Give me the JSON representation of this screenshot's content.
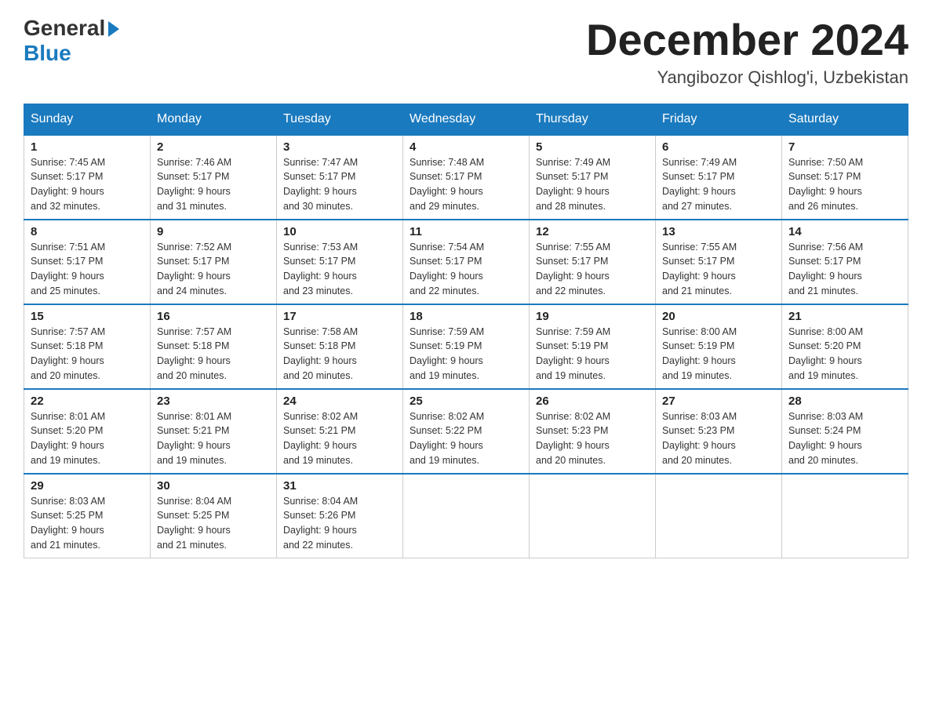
{
  "logo": {
    "general": "General",
    "blue": "Blue"
  },
  "title": "December 2024",
  "location": "Yangibozor Qishlog'i, Uzbekistan",
  "headers": [
    "Sunday",
    "Monday",
    "Tuesday",
    "Wednesday",
    "Thursday",
    "Friday",
    "Saturday"
  ],
  "weeks": [
    [
      {
        "day": "1",
        "sunrise": "7:45 AM",
        "sunset": "5:17 PM",
        "daylight": "9 hours and 32 minutes."
      },
      {
        "day": "2",
        "sunrise": "7:46 AM",
        "sunset": "5:17 PM",
        "daylight": "9 hours and 31 minutes."
      },
      {
        "day": "3",
        "sunrise": "7:47 AM",
        "sunset": "5:17 PM",
        "daylight": "9 hours and 30 minutes."
      },
      {
        "day": "4",
        "sunrise": "7:48 AM",
        "sunset": "5:17 PM",
        "daylight": "9 hours and 29 minutes."
      },
      {
        "day": "5",
        "sunrise": "7:49 AM",
        "sunset": "5:17 PM",
        "daylight": "9 hours and 28 minutes."
      },
      {
        "day": "6",
        "sunrise": "7:49 AM",
        "sunset": "5:17 PM",
        "daylight": "9 hours and 27 minutes."
      },
      {
        "day": "7",
        "sunrise": "7:50 AM",
        "sunset": "5:17 PM",
        "daylight": "9 hours and 26 minutes."
      }
    ],
    [
      {
        "day": "8",
        "sunrise": "7:51 AM",
        "sunset": "5:17 PM",
        "daylight": "9 hours and 25 minutes."
      },
      {
        "day": "9",
        "sunrise": "7:52 AM",
        "sunset": "5:17 PM",
        "daylight": "9 hours and 24 minutes."
      },
      {
        "day": "10",
        "sunrise": "7:53 AM",
        "sunset": "5:17 PM",
        "daylight": "9 hours and 23 minutes."
      },
      {
        "day": "11",
        "sunrise": "7:54 AM",
        "sunset": "5:17 PM",
        "daylight": "9 hours and 22 minutes."
      },
      {
        "day": "12",
        "sunrise": "7:55 AM",
        "sunset": "5:17 PM",
        "daylight": "9 hours and 22 minutes."
      },
      {
        "day": "13",
        "sunrise": "7:55 AM",
        "sunset": "5:17 PM",
        "daylight": "9 hours and 21 minutes."
      },
      {
        "day": "14",
        "sunrise": "7:56 AM",
        "sunset": "5:17 PM",
        "daylight": "9 hours and 21 minutes."
      }
    ],
    [
      {
        "day": "15",
        "sunrise": "7:57 AM",
        "sunset": "5:18 PM",
        "daylight": "9 hours and 20 minutes."
      },
      {
        "day": "16",
        "sunrise": "7:57 AM",
        "sunset": "5:18 PM",
        "daylight": "9 hours and 20 minutes."
      },
      {
        "day": "17",
        "sunrise": "7:58 AM",
        "sunset": "5:18 PM",
        "daylight": "9 hours and 20 minutes."
      },
      {
        "day": "18",
        "sunrise": "7:59 AM",
        "sunset": "5:19 PM",
        "daylight": "9 hours and 19 minutes."
      },
      {
        "day": "19",
        "sunrise": "7:59 AM",
        "sunset": "5:19 PM",
        "daylight": "9 hours and 19 minutes."
      },
      {
        "day": "20",
        "sunrise": "8:00 AM",
        "sunset": "5:19 PM",
        "daylight": "9 hours and 19 minutes."
      },
      {
        "day": "21",
        "sunrise": "8:00 AM",
        "sunset": "5:20 PM",
        "daylight": "9 hours and 19 minutes."
      }
    ],
    [
      {
        "day": "22",
        "sunrise": "8:01 AM",
        "sunset": "5:20 PM",
        "daylight": "9 hours and 19 minutes."
      },
      {
        "day": "23",
        "sunrise": "8:01 AM",
        "sunset": "5:21 PM",
        "daylight": "9 hours and 19 minutes."
      },
      {
        "day": "24",
        "sunrise": "8:02 AM",
        "sunset": "5:21 PM",
        "daylight": "9 hours and 19 minutes."
      },
      {
        "day": "25",
        "sunrise": "8:02 AM",
        "sunset": "5:22 PM",
        "daylight": "9 hours and 19 minutes."
      },
      {
        "day": "26",
        "sunrise": "8:02 AM",
        "sunset": "5:23 PM",
        "daylight": "9 hours and 20 minutes."
      },
      {
        "day": "27",
        "sunrise": "8:03 AM",
        "sunset": "5:23 PM",
        "daylight": "9 hours and 20 minutes."
      },
      {
        "day": "28",
        "sunrise": "8:03 AM",
        "sunset": "5:24 PM",
        "daylight": "9 hours and 20 minutes."
      }
    ],
    [
      {
        "day": "29",
        "sunrise": "8:03 AM",
        "sunset": "5:25 PM",
        "daylight": "9 hours and 21 minutes."
      },
      {
        "day": "30",
        "sunrise": "8:04 AM",
        "sunset": "5:25 PM",
        "daylight": "9 hours and 21 minutes."
      },
      {
        "day": "31",
        "sunrise": "8:04 AM",
        "sunset": "5:26 PM",
        "daylight": "9 hours and 22 minutes."
      },
      null,
      null,
      null,
      null
    ]
  ],
  "labels": {
    "sunrise": "Sunrise:",
    "sunset": "Sunset:",
    "daylight": "Daylight:"
  }
}
